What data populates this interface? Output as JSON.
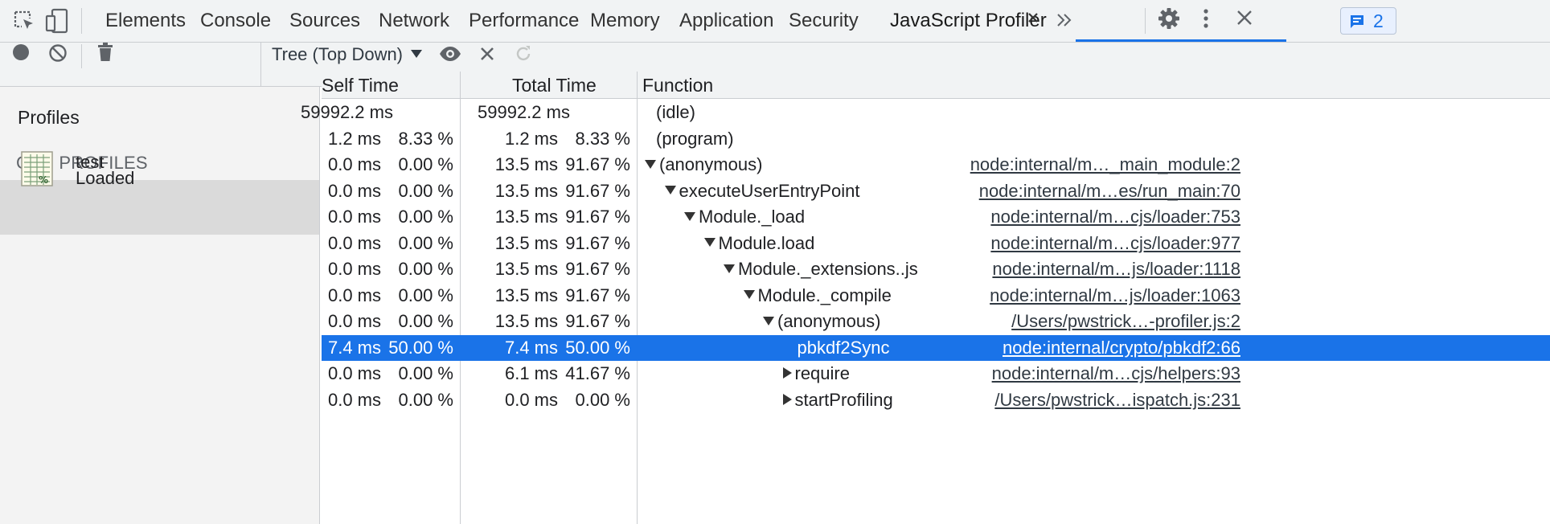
{
  "tabs": [
    {
      "label": "Elements"
    },
    {
      "label": "Console"
    },
    {
      "label": "Sources"
    },
    {
      "label": "Network"
    },
    {
      "label": "Performance"
    },
    {
      "label": "Memory"
    },
    {
      "label": "Application"
    },
    {
      "label": "Security"
    },
    {
      "label": "JavaScript Profiler"
    }
  ],
  "issues_badge": {
    "count": "2"
  },
  "colors": {
    "accent": "#1a73e8",
    "selected_row": "#1a73e8"
  },
  "icons": [
    "inspect-element-icon",
    "device-toolbar-icon",
    "close-tab-icon",
    "more-tabs-icon",
    "issues-icon",
    "settings-icon",
    "more-options-icon",
    "close-devtools-icon",
    "record-icon",
    "clear-icon",
    "delete-icon",
    "dropdown-arrow-icon",
    "focus-eye-icon",
    "exclude-icon",
    "reload-icon",
    "expand-triangle-icon"
  ],
  "toolbar": {
    "view_select": "Tree (Top Down)"
  },
  "sidebar": {
    "title": "Profiles",
    "category": "CPU PROFILES",
    "profile": {
      "name": "test",
      "status": "Loaded"
    }
  },
  "table": {
    "headers": {
      "self": "Self Time",
      "total": "Total Time",
      "function": "Function"
    },
    "rows": [
      {
        "self_ms": "59992.2 ms",
        "self_pct": "",
        "total_ms": "59992.2 ms",
        "total_pct": "",
        "func": "(idle)",
        "url": ""
      },
      {
        "self_ms": "1.2 ms",
        "self_pct": "8.33 %",
        "total_ms": "1.2 ms",
        "total_pct": "8.33 %",
        "func": "(program)",
        "url": ""
      },
      {
        "self_ms": "0.0 ms",
        "self_pct": "0.00 %",
        "total_ms": "13.5 ms",
        "total_pct": "91.67 %",
        "func": "(anonymous)",
        "url": "node:internal/m…_main_module:2"
      },
      {
        "self_ms": "0.0 ms",
        "self_pct": "0.00 %",
        "total_ms": "13.5 ms",
        "total_pct": "91.67 %",
        "func": "executeUserEntryPoint",
        "url": "node:internal/m…es/run_main:70"
      },
      {
        "self_ms": "0.0 ms",
        "self_pct": "0.00 %",
        "total_ms": "13.5 ms",
        "total_pct": "91.67 %",
        "func": "Module._load",
        "url": "node:internal/m…cjs/loader:753"
      },
      {
        "self_ms": "0.0 ms",
        "self_pct": "0.00 %",
        "total_ms": "13.5 ms",
        "total_pct": "91.67 %",
        "func": "Module.load",
        "url": "node:internal/m…cjs/loader:977"
      },
      {
        "self_ms": "0.0 ms",
        "self_pct": "0.00 %",
        "total_ms": "13.5 ms",
        "total_pct": "91.67 %",
        "func": "Module._extensions..js",
        "url": "node:internal/m…js/loader:1118"
      },
      {
        "self_ms": "0.0 ms",
        "self_pct": "0.00 %",
        "total_ms": "13.5 ms",
        "total_pct": "91.67 %",
        "func": "Module._compile",
        "url": "node:internal/m…js/loader:1063"
      },
      {
        "self_ms": "0.0 ms",
        "self_pct": "0.00 %",
        "total_ms": "13.5 ms",
        "total_pct": "91.67 %",
        "func": "(anonymous)",
        "url": "/Users/pwstrick…-profiler.js:2"
      },
      {
        "self_ms": "7.4 ms",
        "self_pct": "50.00 %",
        "total_ms": "7.4 ms",
        "total_pct": "50.00 %",
        "func": "pbkdf2Sync",
        "url": "node:internal/crypto/pbkdf2:66"
      },
      {
        "self_ms": "0.0 ms",
        "self_pct": "0.00 %",
        "total_ms": "6.1 ms",
        "total_pct": "41.67 %",
        "func": "require",
        "url": "node:internal/m…cjs/helpers:93"
      },
      {
        "self_ms": "0.0 ms",
        "self_pct": "0.00 %",
        "total_ms": "0.0 ms",
        "total_pct": "0.00 %",
        "func": "startProfiling",
        "url": "/Users/pwstrick…ispatch.js:231"
      }
    ]
  }
}
